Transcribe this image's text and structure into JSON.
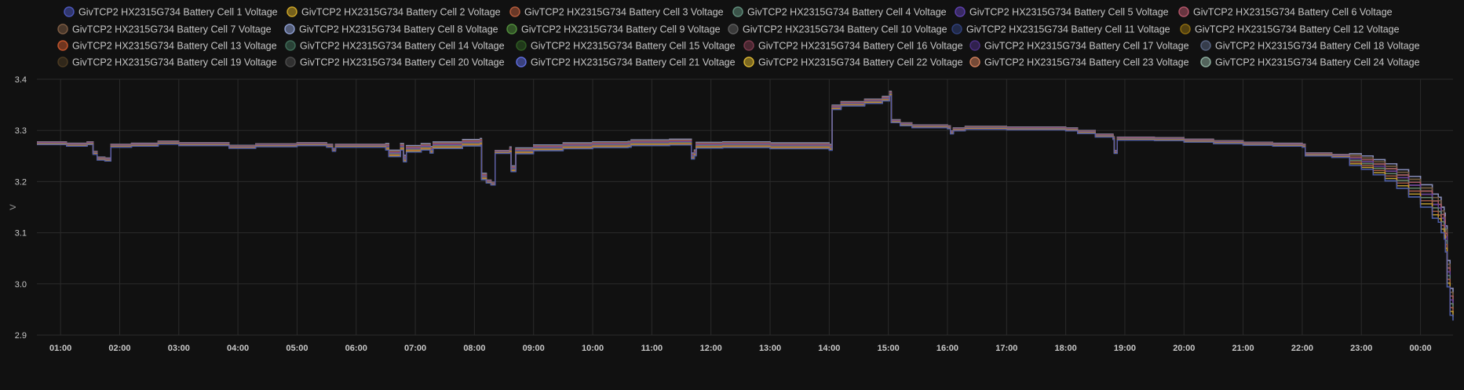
{
  "chart_data": {
    "type": "line",
    "ylabel": "V",
    "ylim": [
      2.9,
      3.4
    ],
    "y_ticks": [
      "3.4",
      "3.3",
      "3.2",
      "3.1",
      "3.0",
      "2.9"
    ],
    "x_range_hours": [
      0.6,
      24.55
    ],
    "x_ticks": [
      "01:00",
      "02:00",
      "03:00",
      "04:00",
      "05:00",
      "06:00",
      "07:00",
      "08:00",
      "09:00",
      "10:00",
      "11:00",
      "12:00",
      "13:00",
      "14:00",
      "15:00",
      "16:00",
      "17:00",
      "18:00",
      "19:00",
      "20:00",
      "21:00",
      "22:00",
      "23:00",
      "00:00"
    ],
    "grid": true,
    "legend_position": "top",
    "line_style": "step",
    "series": [
      {
        "name": "GivTCP2 HX2315G734 Battery Cell 1 Voltage",
        "color": "#4a55b8"
      },
      {
        "name": "GivTCP2 HX2315G734 Battery Cell 2 Voltage",
        "color": "#c9a227"
      },
      {
        "name": "GivTCP2 HX2315G734 Battery Cell 3 Voltage",
        "color": "#b25a3b"
      },
      {
        "name": "GivTCP2 HX2315G734 Battery Cell 4 Voltage",
        "color": "#5e8a78"
      },
      {
        "name": "GivTCP2 HX2315G734 Battery Cell 5 Voltage",
        "color": "#5b3fa8"
      },
      {
        "name": "GivTCP2 HX2315G734 Battery Cell 6 Voltage",
        "color": "#b05468"
      },
      {
        "name": "GivTCP2 HX2315G734 Battery Cell 7 Voltage",
        "color": "#7a5a42"
      },
      {
        "name": "GivTCP2 HX2315G734 Battery Cell 8 Voltage",
        "color": "#8a9acc"
      },
      {
        "name": "GivTCP2 HX2315G734 Battery Cell 9 Voltage",
        "color": "#4f8a3a"
      },
      {
        "name": "GivTCP2 HX2315G734 Battery Cell 10 Voltage",
        "color": "#5c5c5c"
      },
      {
        "name": "GivTCP2 HX2315G734 Battery Cell 11 Voltage",
        "color": "#2f3f78"
      },
      {
        "name": "GivTCP2 HX2315G734 Battery Cell 12 Voltage",
        "color": "#8a6a10"
      },
      {
        "name": "GivTCP2 HX2315G734 Battery Cell 13 Voltage",
        "color": "#c0542c"
      },
      {
        "name": "GivTCP2 HX2315G734 Battery Cell 14 Voltage",
        "color": "#3e6a56"
      },
      {
        "name": "GivTCP2 HX2315G734 Battery Cell 15 Voltage",
        "color": "#2e5a22"
      },
      {
        "name": "GivTCP2 HX2315G734 Battery Cell 16 Voltage",
        "color": "#7a3a4c"
      },
      {
        "name": "GivTCP2 HX2315G734 Battery Cell 17 Voltage",
        "color": "#4a2f80"
      },
      {
        "name": "GivTCP2 HX2315G734 Battery Cell 18 Voltage",
        "color": "#56627e"
      },
      {
        "name": "GivTCP2 HX2315G734 Battery Cell 19 Voltage",
        "color": "#4a3a22"
      },
      {
        "name": "GivTCP2 HX2315G734 Battery Cell 20 Voltage",
        "color": "#4a4a4a"
      },
      {
        "name": "GivTCP2 HX2315G734 Battery Cell 21 Voltage",
        "color": "#5c6ad8"
      },
      {
        "name": "GivTCP2 HX2315G734 Battery Cell 22 Voltage",
        "color": "#d4b030"
      },
      {
        "name": "GivTCP2 HX2315G734 Battery Cell 23 Voltage",
        "color": "#c87a58"
      },
      {
        "name": "GivTCP2 HX2315G734 Battery Cell 24 Voltage",
        "color": "#8aaa9a"
      }
    ],
    "base_curve": [
      [
        0.6,
        3.275
      ],
      [
        1.1,
        3.272
      ],
      [
        1.45,
        3.275
      ],
      [
        1.55,
        3.256
      ],
      [
        1.62,
        3.245
      ],
      [
        1.75,
        3.243
      ],
      [
        1.85,
        3.27
      ],
      [
        2.2,
        3.272
      ],
      [
        2.6,
        3.272
      ],
      [
        2.65,
        3.276
      ],
      [
        3.0,
        3.273
      ],
      [
        3.8,
        3.273
      ],
      [
        3.85,
        3.268
      ],
      [
        4.3,
        3.271
      ],
      [
        5.0,
        3.273
      ],
      [
        5.5,
        3.27
      ],
      [
        5.6,
        3.262
      ],
      [
        5.65,
        3.27
      ],
      [
        6.5,
        3.268
      ],
      [
        6.55,
        3.255
      ],
      [
        6.75,
        3.268
      ],
      [
        6.8,
        3.245
      ],
      [
        6.85,
        3.264
      ],
      [
        7.1,
        3.268
      ],
      [
        7.25,
        3.262
      ],
      [
        7.3,
        3.271
      ],
      [
        7.8,
        3.276
      ],
      [
        8.1,
        3.278
      ],
      [
        8.12,
        3.21
      ],
      [
        8.2,
        3.2
      ],
      [
        8.28,
        3.196
      ],
      [
        8.35,
        3.258
      ],
      [
        8.6,
        3.262
      ],
      [
        8.62,
        3.225
      ],
      [
        8.7,
        3.26
      ],
      [
        9.0,
        3.266
      ],
      [
        9.5,
        3.27
      ],
      [
        10.0,
        3.272
      ],
      [
        10.6,
        3.273
      ],
      [
        10.65,
        3.276
      ],
      [
        11.3,
        3.277
      ],
      [
        11.65,
        3.277
      ],
      [
        11.67,
        3.25
      ],
      [
        11.72,
        3.256
      ],
      [
        11.75,
        3.271
      ],
      [
        12.2,
        3.272
      ],
      [
        13.0,
        3.27
      ],
      [
        14.0,
        3.267
      ],
      [
        14.05,
        3.345
      ],
      [
        14.2,
        3.352
      ],
      [
        14.6,
        3.357
      ],
      [
        14.9,
        3.362
      ],
      [
        15.02,
        3.372
      ],
      [
        15.05,
        3.318
      ],
      [
        15.2,
        3.312
      ],
      [
        15.4,
        3.308
      ],
      [
        16.0,
        3.306
      ],
      [
        16.05,
        3.296
      ],
      [
        16.1,
        3.302
      ],
      [
        16.3,
        3.305
      ],
      [
        17.0,
        3.304
      ],
      [
        17.5,
        3.304
      ],
      [
        18.0,
        3.302
      ],
      [
        18.2,
        3.297
      ],
      [
        18.5,
        3.29
      ],
      [
        18.8,
        3.285
      ],
      [
        18.82,
        3.258
      ],
      [
        18.87,
        3.284
      ],
      [
        19.0,
        3.284
      ],
      [
        19.5,
        3.283
      ],
      [
        20.0,
        3.28
      ],
      [
        20.5,
        3.277
      ],
      [
        21.0,
        3.274
      ],
      [
        21.5,
        3.272
      ],
      [
        22.0,
        3.27
      ],
      [
        22.05,
        3.253
      ],
      [
        22.5,
        3.25
      ],
      [
        22.8,
        3.243
      ],
      [
        23.0,
        3.237
      ],
      [
        23.2,
        3.228
      ],
      [
        23.4,
        3.218
      ],
      [
        23.6,
        3.205
      ],
      [
        23.8,
        3.19
      ],
      [
        24.0,
        3.172
      ],
      [
        24.2,
        3.152
      ],
      [
        24.3,
        3.145
      ],
      [
        24.35,
        3.125
      ],
      [
        24.4,
        3.113
      ],
      [
        24.42,
        3.088
      ],
      [
        24.45,
        3.02
      ],
      [
        24.5,
        2.965
      ],
      [
        24.55,
        2.955
      ]
    ]
  }
}
